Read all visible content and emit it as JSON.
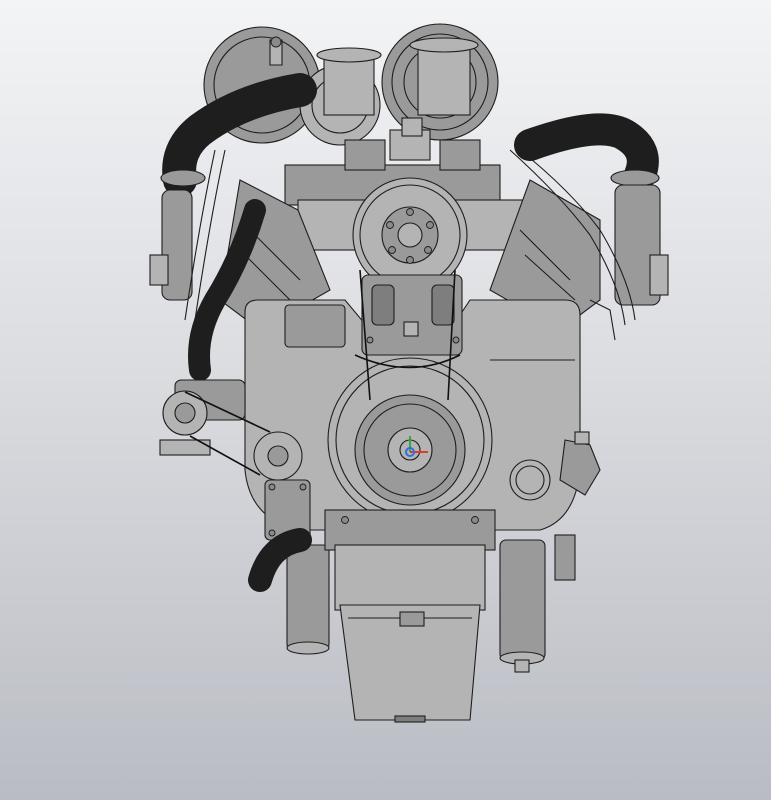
{
  "viewport": {
    "background_top": "#f3f4f6",
    "background_bottom": "#b9bcc3",
    "model_color": "#9a9a9a",
    "edge_color": "#1e1e1e"
  },
  "triad": {
    "x_color": "#e03a2f",
    "y_color": "#3aa53a",
    "z_color": "#2f6fe0"
  }
}
